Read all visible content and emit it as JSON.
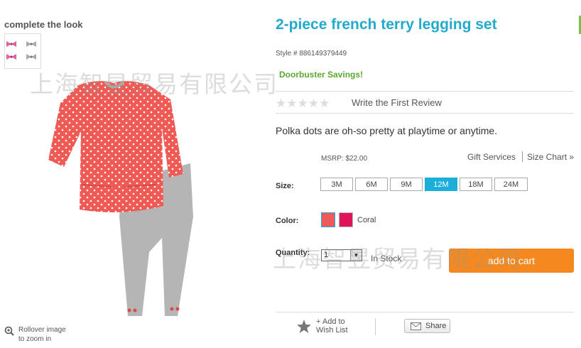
{
  "left_panel": {
    "complete_the_look": "complete the look",
    "rollover_line1": "Rollover image",
    "rollover_line2": "to zoom in"
  },
  "product": {
    "title": "2-piece french terry legging set",
    "style": "Style # 886149379449",
    "promo": "Doorbuster Savings!",
    "review_link": "Write the First Review",
    "description": "Polka dots are oh-so pretty at playtime or anytime.",
    "msrp": "MSRP: $22.00",
    "rating_stars": "★★★★★"
  },
  "links": {
    "gift_services": "Gift Services",
    "size_chart": "Size Chart »"
  },
  "size": {
    "label": "Size:",
    "options": [
      "3M",
      "6M",
      "9M",
      "12M",
      "18M",
      "24M"
    ],
    "selected": "12M"
  },
  "color": {
    "label": "Color:",
    "selected_name": "Coral",
    "swatches": [
      "#ee5a5a",
      "#e01456"
    ]
  },
  "quantity": {
    "label": "Quantity:",
    "value": "1",
    "stock": "In Stock"
  },
  "add_to_cart": "add to cart",
  "wish_list": {
    "line1": "+ Add to",
    "line2": "Wish List"
  },
  "share_label": "Share",
  "watermark": "上海智昱贸易有限公司",
  "colors": {
    "title": "#22aacc",
    "promo": "#5aa832",
    "accent": "#f5891f",
    "selected_size": "#1aaed9",
    "divider": "#7cc242"
  }
}
